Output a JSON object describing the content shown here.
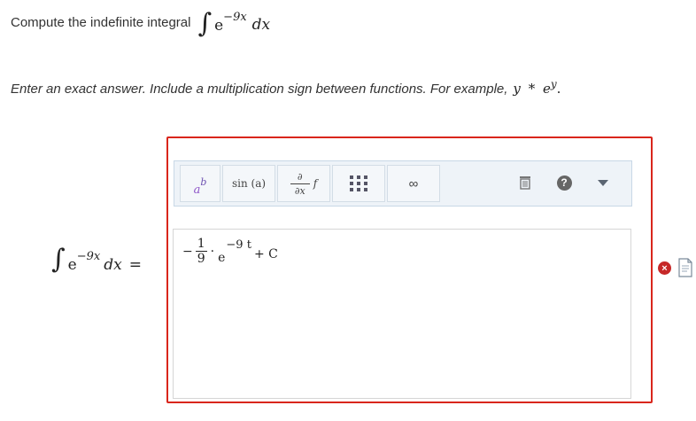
{
  "question": {
    "prefix": "Compute the indefinite integral",
    "integral_symbol": "∫",
    "base": "e",
    "exponent": "−9x",
    "differential": "dx"
  },
  "instruction": {
    "text": "Enter an exact answer. Include a multiplication sign between functions. For example,",
    "example_lhs": "y",
    "example_op": "*",
    "example_base": "e",
    "example_exp": "y",
    "example_period": "."
  },
  "toolbar": {
    "power_base": "a",
    "power_exp": "b",
    "sin_label": "sin (a)",
    "deriv_num": "∂",
    "deriv_den": "∂x",
    "deriv_fn": "f",
    "infinity_label": "∞",
    "help_label": "?",
    "icons": [
      "power-icon",
      "sin-icon",
      "partial-derivative-icon",
      "matrix-icon",
      "infinity-icon",
      "trash-icon",
      "help-icon",
      "more-arrow-icon"
    ]
  },
  "answer": {
    "minus": "−",
    "numerator": "1",
    "denominator": "9",
    "dot": "·",
    "base": "e",
    "exponent": "−9 t",
    "plus_c": "+ C"
  },
  "lhs": {
    "integral_symbol": "∫",
    "base": "e",
    "exponent": "−9x",
    "differential": "dx",
    "equals": "="
  },
  "status": {
    "error_mark": "×",
    "error_color": "#c62828",
    "frame_color": "#d9261c"
  }
}
